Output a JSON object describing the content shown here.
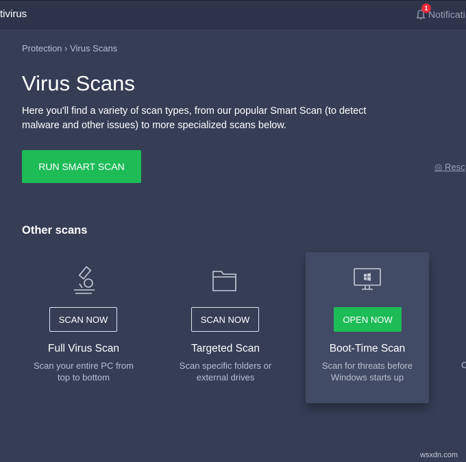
{
  "header": {
    "app_title": "tivirus",
    "notifications_label": "Notificati",
    "notification_count": "1"
  },
  "breadcrumb": {
    "parent": "Protection",
    "separator": "›",
    "current": "Virus Scans"
  },
  "page": {
    "title": "Virus Scans",
    "description": "Here you'll find a variety of scan types, from our popular Smart Scan (to detect malware and other issues) to more specialized scans below.",
    "run_button": "RUN SMART SCAN",
    "rescue_link": "Resc"
  },
  "other_scans": {
    "heading": "Other scans",
    "cards": [
      {
        "icon": "microscope-icon",
        "button": "SCAN NOW",
        "title": "Full Virus Scan",
        "desc": "Scan your entire PC from top to bottom"
      },
      {
        "icon": "folder-icon",
        "button": "SCAN NOW",
        "title": "Targeted Scan",
        "desc": "Scan specific folders or external drives"
      },
      {
        "icon": "windows-monitor-icon",
        "button": "OPEN NOW",
        "title": "Boot-Time Scan",
        "desc": "Scan for threats before Windows starts up"
      }
    ],
    "partial_card_text": "C"
  },
  "watermark": "wsxdn.com",
  "colors": {
    "accent_green": "#1ebc57",
    "badge_red": "#e8283c",
    "background": "#353e55"
  }
}
